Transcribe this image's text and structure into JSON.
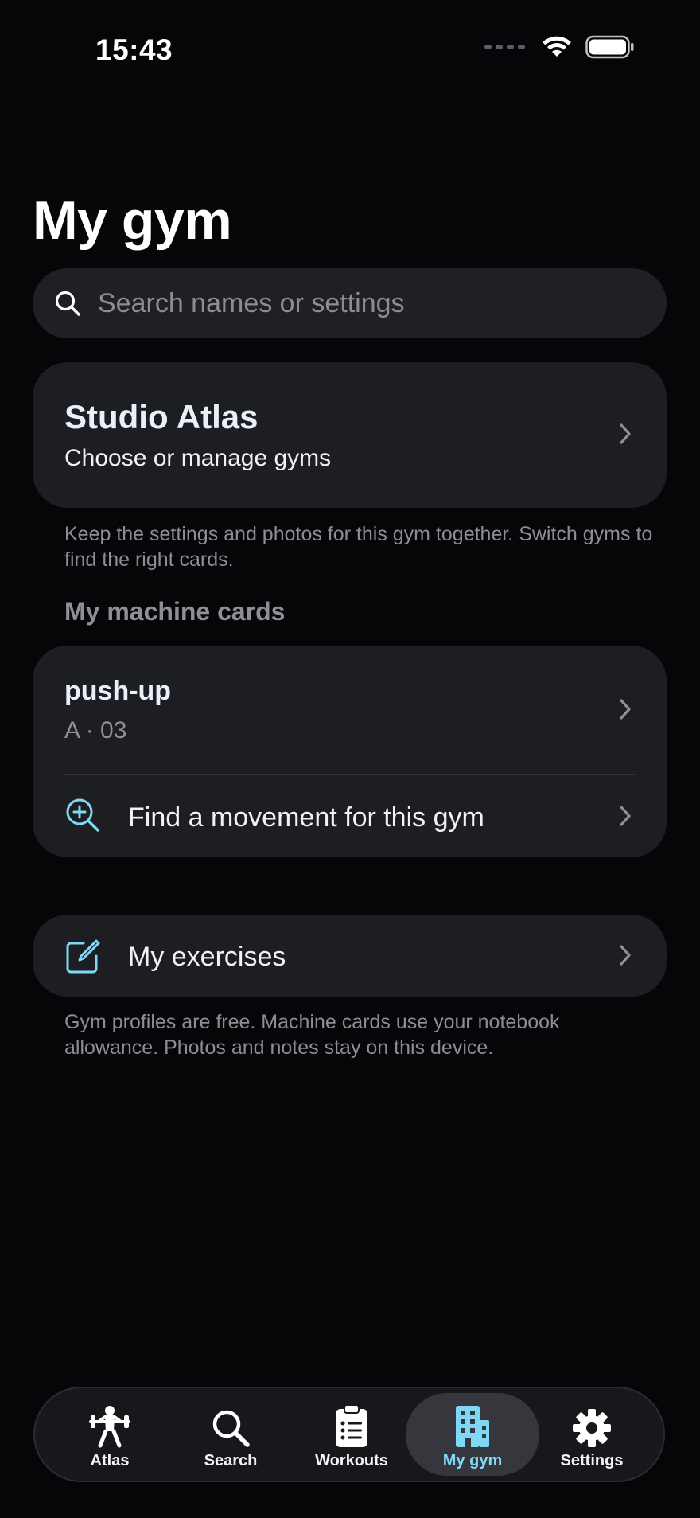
{
  "status_bar": {
    "time": "15:43"
  },
  "title": "My gym",
  "search": {
    "placeholder": "Search names or settings"
  },
  "gym": {
    "name": "Studio Atlas",
    "subtitle": "Choose or manage gyms",
    "footnote": "Keep the settings and photos for this gym together. Switch gyms to find the right cards."
  },
  "machine_section": {
    "header": "My machine cards",
    "card": {
      "name": "push-up",
      "code": "A · 03"
    },
    "find_label": "Find a movement for this gym"
  },
  "exercises": {
    "label": "My exercises",
    "footnote": "Gym profiles are free. Machine cards use your notebook allowance. Photos and notes stay on this device."
  },
  "tabs": [
    {
      "label": "Atlas",
      "icon": "weightlifter-icon",
      "active": false
    },
    {
      "label": "Search",
      "icon": "search-icon",
      "active": false
    },
    {
      "label": "Workouts",
      "icon": "clipboard-icon",
      "active": false
    },
    {
      "label": "My gym",
      "icon": "building-icon",
      "active": true
    },
    {
      "label": "Settings",
      "icon": "gear-icon",
      "active": false
    }
  ],
  "colors": {
    "accent": "#7fd8f5",
    "background": "#050608",
    "card": "#1d1e22"
  }
}
